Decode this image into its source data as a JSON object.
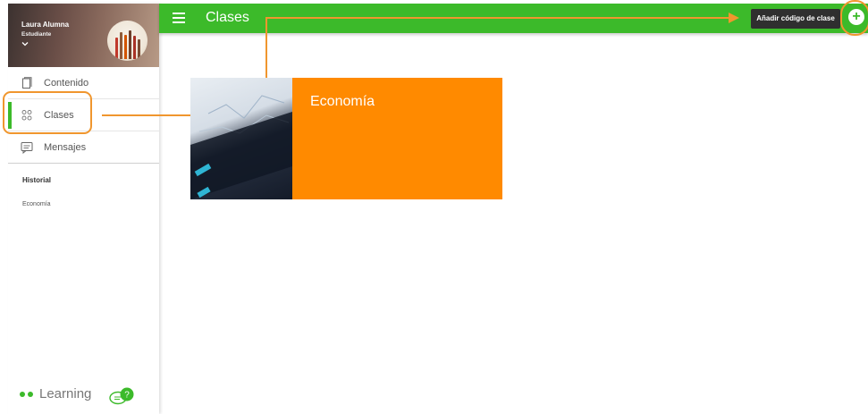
{
  "sidebar": {
    "user_name": "Laura Alumna",
    "user_role": "Estudiante",
    "menu": [
      {
        "label": "Contenido",
        "icon": "book-icon"
      },
      {
        "label": "Clases",
        "icon": "group-icon"
      },
      {
        "label": "Mensajes",
        "icon": "message-icon"
      }
    ],
    "history_title": "Historial",
    "history_items": [
      "Economía"
    ],
    "brand": "Learning",
    "chat_badge": "?"
  },
  "header": {
    "title": "Clases",
    "add_tooltip": "Añadir código de clase",
    "add_icon": "plus-circle-icon"
  },
  "cards": [
    {
      "title": "Economía",
      "color": "#ff8a00"
    }
  ],
  "colors": {
    "accent_green": "#3cba2a",
    "highlight_orange": "#f0962e",
    "card_orange": "#ff8a00"
  }
}
